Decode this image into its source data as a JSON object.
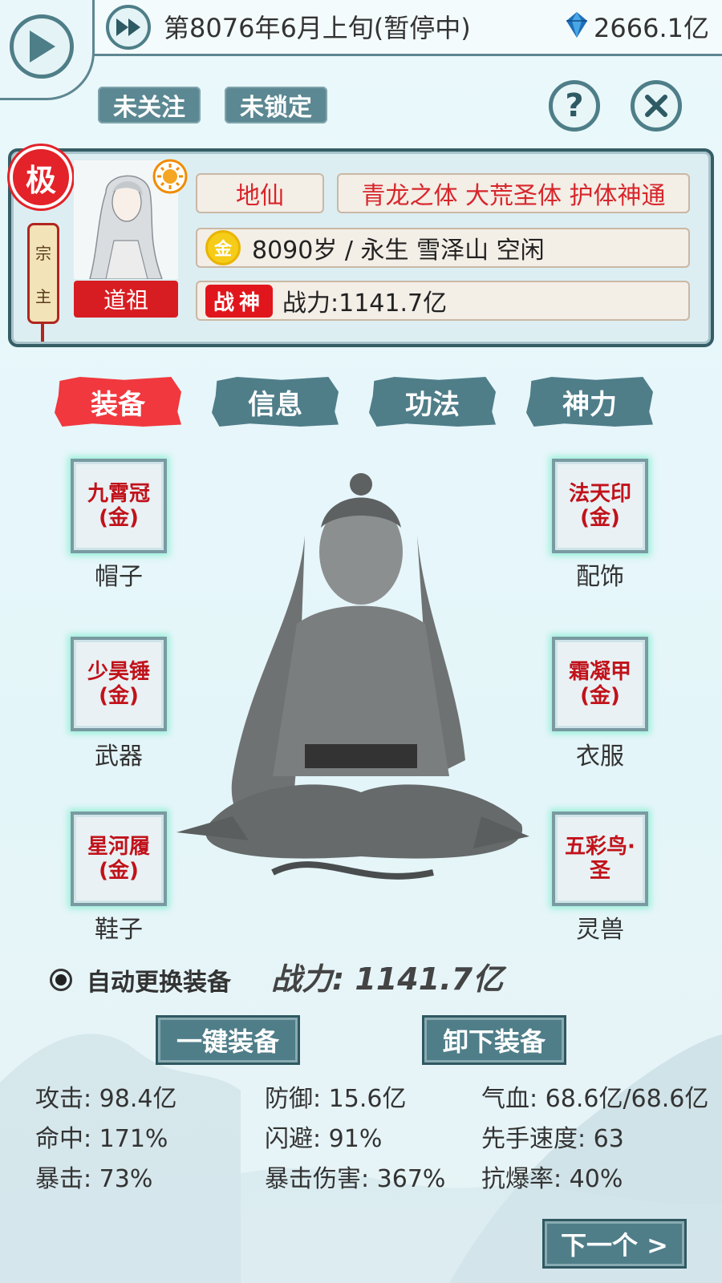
{
  "header": {
    "date": "第8076年6月上旬(暂停中)",
    "spirit_stones": "2666.1亿"
  },
  "status": {
    "follow": "未关注",
    "lock": "未锁定"
  },
  "character": {
    "grade_badge": "极",
    "position": [
      "宗",
      "主"
    ],
    "title": "道祖",
    "realm": "地仙",
    "talents": "青龙之体 大荒圣体 护体神通",
    "element": "金",
    "age_info": "8090岁 / 永生 雪泽山 空闲",
    "war_god_badge": "战神",
    "combat_power": "战力:1141.7亿"
  },
  "tabs": [
    {
      "label": "装备",
      "active": true
    },
    {
      "label": "信息",
      "active": false
    },
    {
      "label": "功法",
      "active": false
    },
    {
      "label": "神力",
      "active": false
    }
  ],
  "equipment": {
    "hat": {
      "item": "九霄冠(金)",
      "label": "帽子"
    },
    "accessory": {
      "item": "法天印(金)",
      "label": "配饰"
    },
    "weapon": {
      "item": "少昊锤(金)",
      "label": "武器"
    },
    "clothes": {
      "item": "霜凝甲(金)",
      "label": "衣服"
    },
    "shoes": {
      "item": "星河履(金)",
      "label": "鞋子"
    },
    "pet": {
      "item": "五彩鸟·圣",
      "label": "灵兽"
    }
  },
  "auto_equip": {
    "label": "自动更换装备",
    "checked": true,
    "power": "战力: 1141.7亿"
  },
  "actions": {
    "equip_all": "一键装备",
    "unequip": "卸下装备",
    "next": "下一个 >"
  },
  "stats": [
    [
      "攻击: 98.4亿",
      "防御: 15.6亿",
      "气血: 68.6亿/68.6亿"
    ],
    [
      "命中: 171%",
      "闪避: 91%",
      "先手速度: 63"
    ],
    [
      "暴击: 73%",
      "暴击伤害: 367%",
      "抗爆率: 40%"
    ]
  ],
  "colors": {
    "teal": "#4f7e89",
    "red": "#f0383e",
    "accent_red": "#d8262b",
    "background": "#e6f6f9"
  }
}
